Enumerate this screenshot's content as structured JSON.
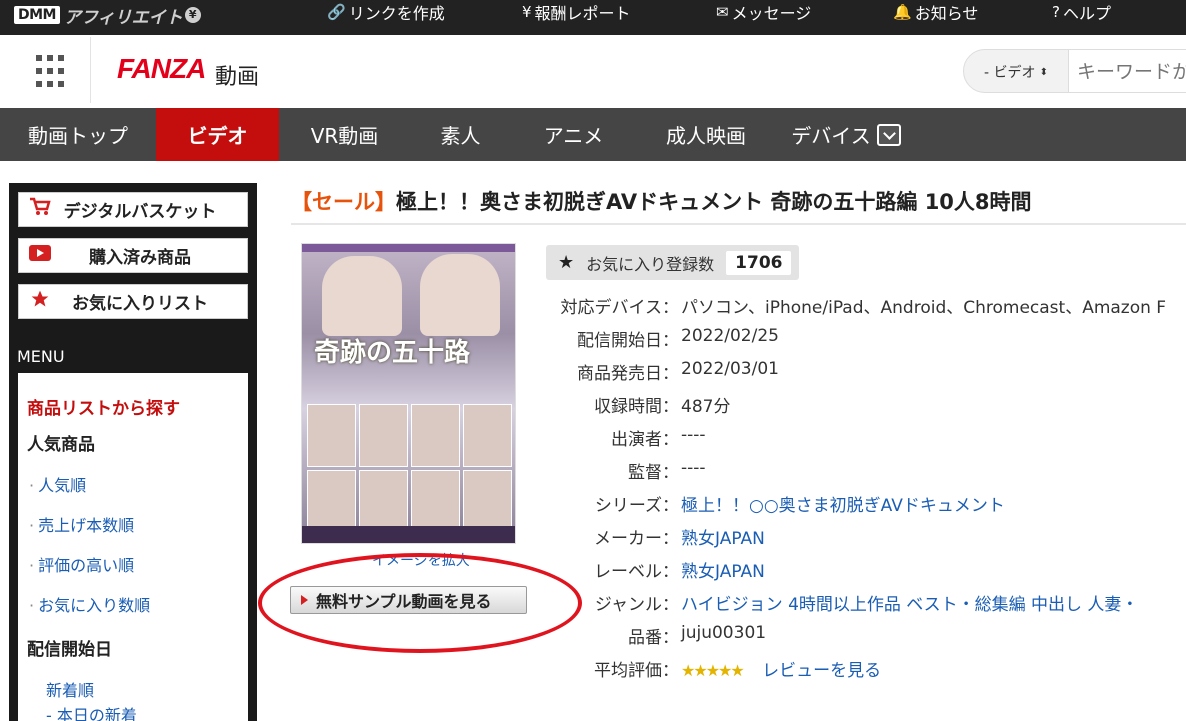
{
  "topbar": {
    "logo_box": "DMM",
    "logo_text": "アフィリエイト",
    "logo_badge": "¥",
    "nav": [
      {
        "icon": "link-icon",
        "label": "リンクを作成"
      },
      {
        "icon": "yen-icon",
        "label": "報酬レポート"
      },
      {
        "icon": "mail-icon",
        "label": "メッセージ"
      },
      {
        "icon": "bell-icon",
        "label": "お知らせ"
      },
      {
        "icon": "help-icon",
        "label": "ヘルプ"
      }
    ]
  },
  "header": {
    "brand": "FANZA",
    "section": "動画",
    "search_select": "- ビデオ",
    "search_placeholder": "キーワードか"
  },
  "mainnav": [
    {
      "label": "動画トップ",
      "active": false
    },
    {
      "label": "ビデオ",
      "active": true
    },
    {
      "label": "VR動画",
      "active": false
    },
    {
      "label": "素人",
      "active": false
    },
    {
      "label": "アニメ",
      "active": false
    },
    {
      "label": "成人映画",
      "active": false
    },
    {
      "label": "デバイス",
      "active": false
    }
  ],
  "sidebar": {
    "buttons": [
      {
        "icon": "cart-icon",
        "label": "デジタルバスケット"
      },
      {
        "icon": "play-icon",
        "label": "購入済み商品"
      },
      {
        "icon": "star-icon",
        "label": "お気に入りリスト"
      }
    ],
    "menu_title": "MENU",
    "menu": {
      "section_red": "商品リストから探す",
      "popular_title": "人気商品",
      "popular_links": [
        "人気順",
        "売上げ本数順",
        "評価の高い順",
        "お気に入り数順"
      ],
      "release_title": "配信開始日",
      "release_links": [
        "新着順",
        "- 本日の新着"
      ]
    }
  },
  "product": {
    "sale_tag": "【セール】",
    "title": "極上！！奥さま初脱ぎAVドキュメント 奇跡の五十路編 10人8時間",
    "cover_headline": "奇跡の五十路",
    "enlarge_label": "イメージを拡大",
    "sample_button": "無料サンプル動画を見る",
    "favorite_label": "お気に入り登録数",
    "favorite_count": "1706",
    "details": [
      {
        "key": "対応デバイス：",
        "value": "パソコン、iPhone/iPad、Android、Chromecast、Amazon F",
        "link": false
      },
      {
        "key": "配信開始日：",
        "value": "2022/02/25",
        "link": false
      },
      {
        "key": "商品発売日：",
        "value": "2022/03/01",
        "link": false
      },
      {
        "key": "収録時間：",
        "value": "487分",
        "link": false
      },
      {
        "key": "出演者：",
        "value": "----",
        "link": false
      },
      {
        "key": "監督：",
        "value": "----",
        "link": false
      },
      {
        "key": "シリーズ：",
        "value": "極上！！○○奥さま初脱ぎAVドキュメント",
        "link": true
      },
      {
        "key": "メーカー：",
        "value": "熟女JAPAN",
        "link": true
      },
      {
        "key": "レーベル：",
        "value": "熟女JAPAN",
        "link": true
      },
      {
        "key": "ジャンル：",
        "value": "ハイビジョン  4時間以上作品  ベスト・総集編  中出し  人妻・",
        "link": true
      },
      {
        "key": "品番：",
        "value": "juju00301",
        "link": false
      }
    ],
    "rating_key": "平均評価：",
    "rating_stars": "★★★★★",
    "review_link": "レビューを見る"
  }
}
